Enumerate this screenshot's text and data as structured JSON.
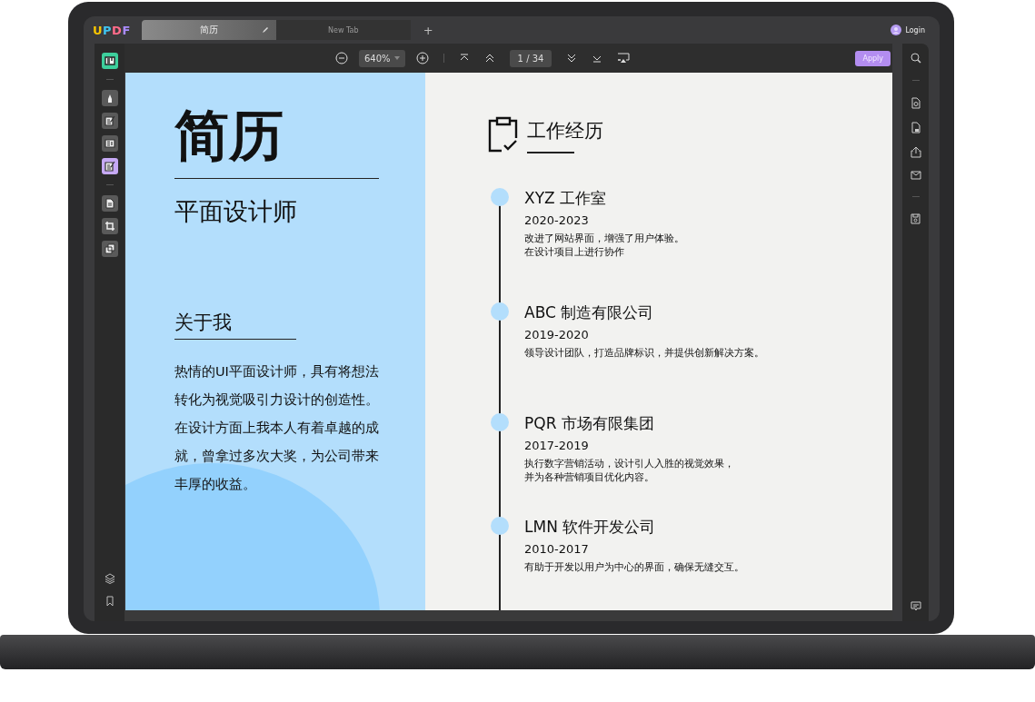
{
  "app": {
    "logo": "UPDF",
    "login": "Login"
  },
  "tabs": [
    {
      "label": "简历",
      "selected": true
    },
    {
      "label": "New Tab",
      "selected": false
    }
  ],
  "new_tab": "+",
  "toolbar": {
    "zoom": "640%",
    "page": "1",
    "separator": "/",
    "page_count": "34",
    "apply": "Apply"
  },
  "left_tools": [
    {
      "kind": "reader",
      "selected": false
    },
    {
      "kind": "comment",
      "selected": false
    },
    {
      "kind": "edit",
      "selected": false
    },
    {
      "kind": "columns",
      "selected": false
    },
    {
      "kind": "form",
      "selected": true
    },
    {
      "kind": "pages",
      "selected": false
    },
    {
      "kind": "crop",
      "selected": false
    },
    {
      "kind": "watermark",
      "selected": false
    }
  ],
  "document": {
    "title": "简历",
    "subtitle": "平面设计师",
    "about_heading": "关于我",
    "about_text": "热情的UI平面设计师，具有将想法转化为视觉吸引力设计的创造性。在设计方面上我本人有着卓越的成就，曾拿过多次大奖，为公司带来丰厚的收益。",
    "experience_heading": "工作经历",
    "jobs": [
      {
        "company": "XYZ 工作室",
        "years": "2020-2023",
        "description": [
          "改进了网站界面，增强了用户体验。",
          "在设计项目上进行协作"
        ]
      },
      {
        "company": "ABC 制造有限公司",
        "years": "2019-2020",
        "description": [
          "领导设计团队，打造品牌标识，并提供创新解决方案。"
        ]
      },
      {
        "company": "PQR 市场有限集团",
        "years": "2017-2019",
        "description": [
          "执行数字营销活动，设计引人入胜的视觉效果，",
          "并为各种营销项目优化内容。"
        ]
      },
      {
        "company": "LMN 软件开发公司",
        "years": "2010-2017",
        "description": [
          "有助于开发以用户为中心的界面，确保无缝交互。"
        ]
      }
    ]
  }
}
